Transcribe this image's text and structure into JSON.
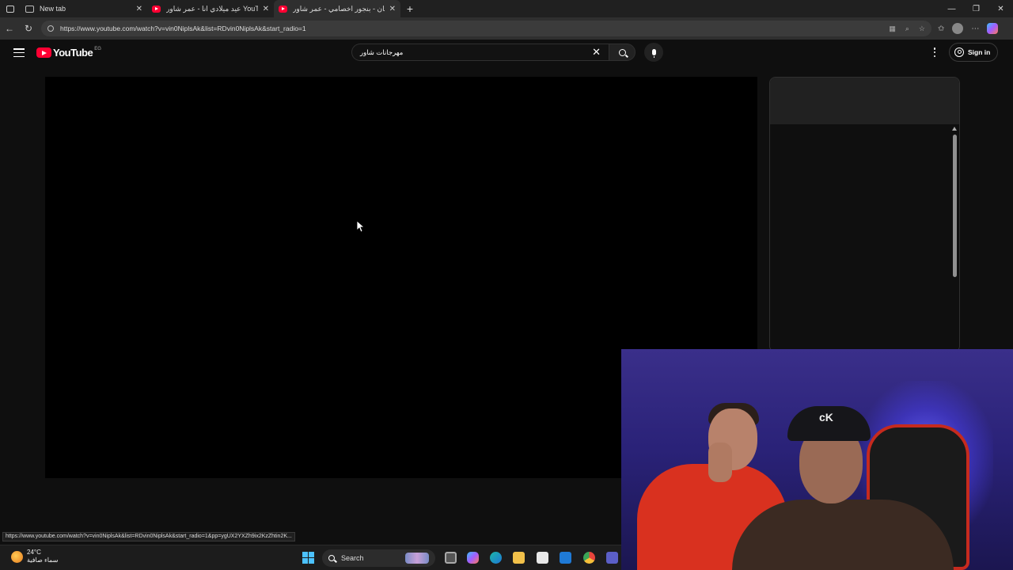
{
  "browser": {
    "tabs": [
      {
        "title": "New tab",
        "icon": "new-tab-icon",
        "active": false
      },
      {
        "title": "عيد ميلادي انا - عمر شاور YouTube",
        "icon": "youtube-favicon",
        "active": false
      },
      {
        "title": "مهرجان - بنجور اخصامي - عمر شاور",
        "icon": "youtube-favicon",
        "active": true
      }
    ],
    "new_tab_glyph": "+",
    "close_glyph": "✕",
    "url": "https://www.youtube.com/watch?v=vin0NiplsAk&list=RDvin0NiplsAk&start_radio=1",
    "window_controls": {
      "minimize": "—",
      "restore": "❐",
      "close": "✕"
    },
    "nav": {
      "back": "←",
      "refresh": "↻"
    }
  },
  "youtube": {
    "logo_text": "YouTube",
    "country_code": "EG",
    "search_query": "مهرجانات شاور",
    "clear_glyph": "✕",
    "signin_label": "Sign in"
  },
  "status_bar": {
    "link_preview": "https://www.youtube.com/watch?v=vin0NiplsAk&list=RDvin0NiplsAk&start_radio=1&pp=ygUX2YXZh9ix2KzZhtin2K..."
  },
  "taskbar": {
    "weather_temp": "24°C",
    "weather_desc": "سماء صافية",
    "search_label": "Search",
    "apps": [
      "task-view-icon",
      "copilot-icon",
      "edge-icon",
      "file-explorer-icon",
      "store-icon",
      "mail-icon",
      "chrome-icon",
      "teams-icon"
    ]
  },
  "colors": {
    "youtube_red": "#ff0033",
    "page_bg": "#0f0f0f",
    "windows_accent": "#4cc2ff"
  }
}
